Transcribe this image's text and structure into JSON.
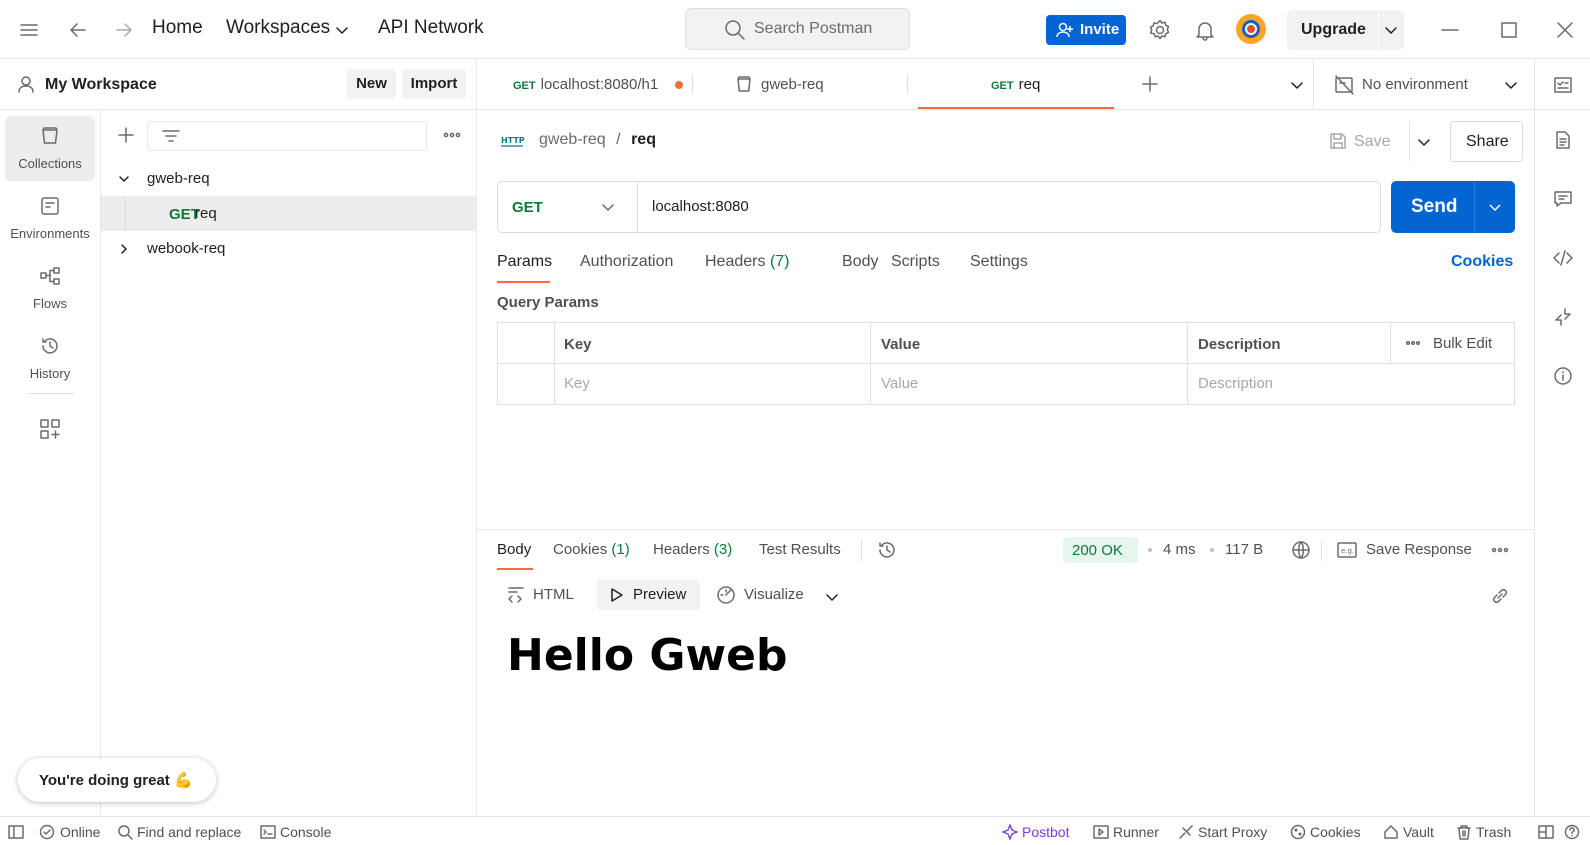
{
  "topbar": {
    "home": "Home",
    "workspaces": "Workspaces",
    "api_network": "API Network",
    "search_placeholder": "Search Postman",
    "invite": "Invite",
    "upgrade": "Upgrade"
  },
  "workspace": {
    "name": "My Workspace",
    "new_label": "New",
    "import_label": "Import"
  },
  "rail": [
    {
      "label": "Collections",
      "icon": "collections-icon"
    },
    {
      "label": "Environments",
      "icon": "environments-icon"
    },
    {
      "label": "Flows",
      "icon": "flows-icon"
    },
    {
      "label": "History",
      "icon": "history-icon"
    }
  ],
  "tree": {
    "collections": [
      {
        "name": "gweb-req",
        "expanded": true,
        "requests": [
          {
            "method": "GET",
            "name": "req"
          }
        ]
      },
      {
        "name": "webook-req",
        "expanded": false
      }
    ]
  },
  "toast": "You're doing great 💪",
  "tabs": [
    {
      "method": "GET",
      "label": "localhost:8080/h1",
      "unsaved": true
    },
    {
      "method": "",
      "label": "gweb-req"
    },
    {
      "method": "GET",
      "label": "req",
      "active": true
    }
  ],
  "environment": "No environment",
  "request": {
    "breadcrumb_collection": "gweb-req",
    "breadcrumb_sep": "/",
    "breadcrumb_request": "req",
    "save": "Save",
    "share": "Share",
    "method": "GET",
    "url": "localhost:8080",
    "send": "Send",
    "subtabs": {
      "params": "Params",
      "authorization": "Authorization",
      "headers": "Headers",
      "headers_count": "(7)",
      "body": "Body",
      "scripts": "Scripts",
      "settings": "Settings"
    },
    "cookies": "Cookies",
    "query_params_title": "Query Params",
    "table": {
      "headers": [
        "Key",
        "Value",
        "Description"
      ],
      "bulk_edit": "Bulk Edit",
      "placeholders": [
        "Key",
        "Value",
        "Description"
      ]
    }
  },
  "response": {
    "tabs": {
      "body": "Body",
      "cookies": "Cookies",
      "cookies_count": "(1)",
      "headers": "Headers",
      "headers_count": "(3)",
      "test_results": "Test Results"
    },
    "status": "200 OK",
    "time": "4 ms",
    "size": "117 B",
    "save_response": "Save Response",
    "views": {
      "html": "HTML",
      "preview": "Preview",
      "visualize": "Visualize"
    },
    "preview_text": "Hello Gweb"
  },
  "statusbar": {
    "online": "Online",
    "find_replace": "Find and replace",
    "console": "Console",
    "postbot": "Postbot",
    "runner": "Runner",
    "start_proxy": "Start Proxy",
    "cookies": "Cookies",
    "vault": "Vault",
    "trash": "Trash"
  },
  "colors": {
    "accent": "#ff6c37",
    "primary_blue": "#0265d2",
    "get_green": "#0d7a3d"
  }
}
